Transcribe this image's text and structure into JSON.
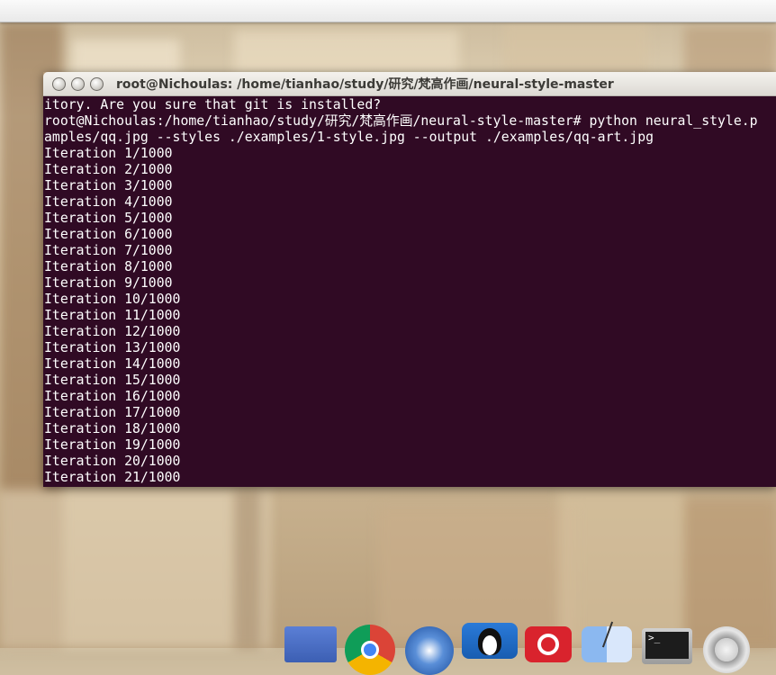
{
  "window": {
    "title": "root@Nichoulas: /home/tianhao/study/研究/梵高作画/neural-style-master"
  },
  "terminal": {
    "lines": [
      "itory. Are you sure that git is installed?",
      "root@Nichoulas:/home/tianhao/study/研究/梵高作画/neural-style-master# python neural_style.p",
      "amples/qq.jpg --styles ./examples/1-style.jpg --output ./examples/qq-art.jpg",
      "Iteration 1/1000",
      "Iteration 2/1000",
      "Iteration 3/1000",
      "Iteration 4/1000",
      "Iteration 5/1000",
      "Iteration 6/1000",
      "Iteration 7/1000",
      "Iteration 8/1000",
      "Iteration 9/1000",
      "Iteration 10/1000",
      "Iteration 11/1000",
      "Iteration 12/1000",
      "Iteration 13/1000",
      "Iteration 14/1000",
      "Iteration 15/1000",
      "Iteration 16/1000",
      "Iteration 17/1000",
      "Iteration 18/1000",
      "Iteration 19/1000",
      "Iteration 20/1000",
      "Iteration 21/1000"
    ]
  },
  "dock": {
    "icons": [
      "folder-icon",
      "chrome-icon",
      "app-store-icon",
      "qq-icon",
      "netease-music-icon",
      "finder-icon",
      "terminal-icon",
      "settings-icon"
    ]
  },
  "colors": {
    "terminal_bg": "#300a24",
    "terminal_fg": "#ffffff"
  }
}
